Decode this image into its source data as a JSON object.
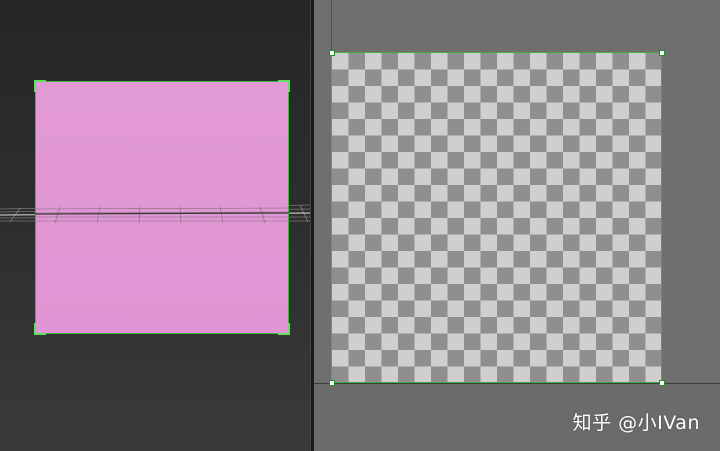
{
  "viewport": {
    "background": "#2e2e2e",
    "plane_color": "#e29ad6",
    "selection_color": "#3fb73f"
  },
  "uv_editor": {
    "background": "#6f6f6f",
    "checker_light": "#cfcfcf",
    "checker_dark": "#8f8f8f"
  },
  "watermark": {
    "text": "知乎 @小IVan"
  }
}
